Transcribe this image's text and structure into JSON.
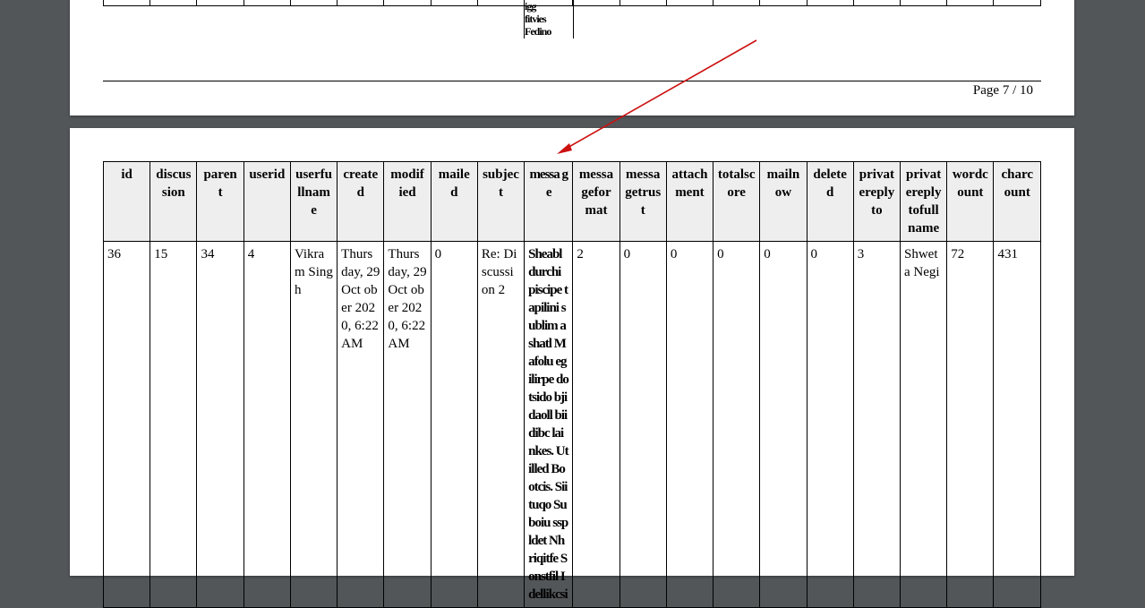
{
  "viewer": {
    "page_indicator": "Page 7 / 10"
  },
  "top_page": {
    "overlap_text": [
      "igg",
      "fitvies",
      "Fedino"
    ]
  },
  "table": {
    "headers": [
      "id",
      "discus sion",
      "paren t",
      "userid",
      "userfu llnam e",
      "create d",
      "modif ied",
      "maile d",
      "subjec t",
      "messa ge",
      "messa gefor mat",
      "messa getrus t",
      "attach ment",
      "totalsc ore",
      "mailn ow",
      "delete d",
      "privat ereply to",
      "privat ereply tofull name",
      "wordc ount",
      "charc ount"
    ],
    "row": {
      "id": "36",
      "discussion": "15",
      "parent": "34",
      "userid": "4",
      "userfullname": "Vikra m Singh",
      "created": "Thurs day, 29 Oct ober 2020, 6:22 AM",
      "modified": "Thurs day, 29 Oct ober 2020, 6:22 AM",
      "mailed": "0",
      "subject": "Re: Di scussi on 2",
      "message": "Sheabl durchi piscipe tapilini sublim ashatl Mafolu egilirpe dotsido bjidaoll biidibc lainkes. Utilled Bootcis. Siituqo Suboiu sspldet Nhriqitfe Sonstfil Idellikcsi",
      "messageformat": "2",
      "messagetrust": "0",
      "attachment": "0",
      "totalscore": "0",
      "mailnow": "0",
      "deleted": "0",
      "privatereplyto": "3",
      "privatereplytofullname": "Shwet a Negi",
      "wordcount": "72",
      "charcount": "431"
    }
  },
  "colors": {
    "viewer_bg": "#525659",
    "header_bg": "#eeeeee",
    "arrow": "#cc1111"
  }
}
